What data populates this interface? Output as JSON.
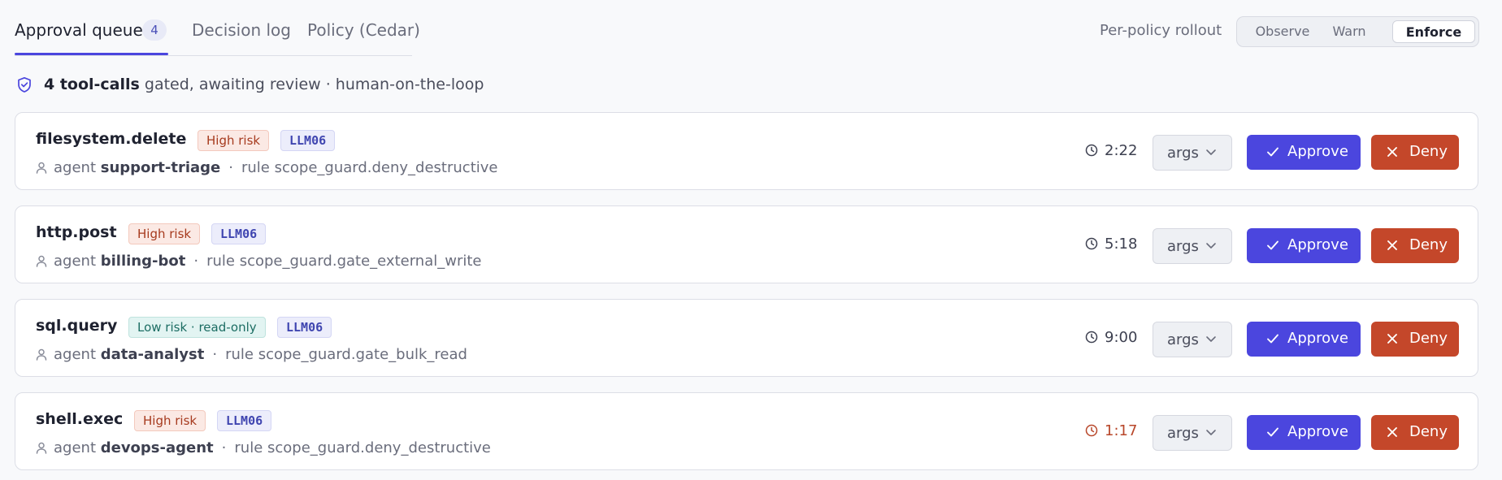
{
  "tabs": [
    {
      "label": "Approval queue",
      "count": "4"
    },
    {
      "label": "Decision log"
    },
    {
      "label": "Policy (Cedar)"
    }
  ],
  "rollout": {
    "label": "Per-policy rollout",
    "options": [
      "Observe",
      "Warn",
      "Enforce"
    ],
    "selected": "Enforce"
  },
  "summary": {
    "count_text": "4 tool-calls",
    "rest_text": "gated, awaiting review · human-on-the-loop"
  },
  "card_labels": {
    "agent": "agent",
    "rule": "rule",
    "args": "args",
    "approve": "Approve",
    "deny": "Deny"
  },
  "colors": {
    "accent": "#4b46de",
    "danger": "#c4472a",
    "high_risk": "#a63a1e",
    "low_risk": "#1c6d63"
  },
  "queue": [
    {
      "tool": "filesystem.delete",
      "risk": "High risk",
      "risk_level": "high",
      "tag": "LLM06",
      "agent": "support-triage",
      "rule": "scope_guard.deny_destructive",
      "timer": "2:22",
      "urgent": false
    },
    {
      "tool": "http.post",
      "risk": "High risk",
      "risk_level": "high",
      "tag": "LLM06",
      "agent": "billing-bot",
      "rule": "scope_guard.gate_external_write",
      "timer": "5:18",
      "urgent": false
    },
    {
      "tool": "sql.query",
      "risk": "Low risk · read-only",
      "risk_level": "low",
      "tag": "LLM06",
      "agent": "data-analyst",
      "rule": "scope_guard.gate_bulk_read",
      "timer": "9:00",
      "urgent": false
    },
    {
      "tool": "shell.exec",
      "risk": "High risk",
      "risk_level": "high",
      "tag": "LLM06",
      "agent": "devops-agent",
      "rule": "scope_guard.deny_destructive",
      "timer": "1:17",
      "urgent": true
    }
  ]
}
